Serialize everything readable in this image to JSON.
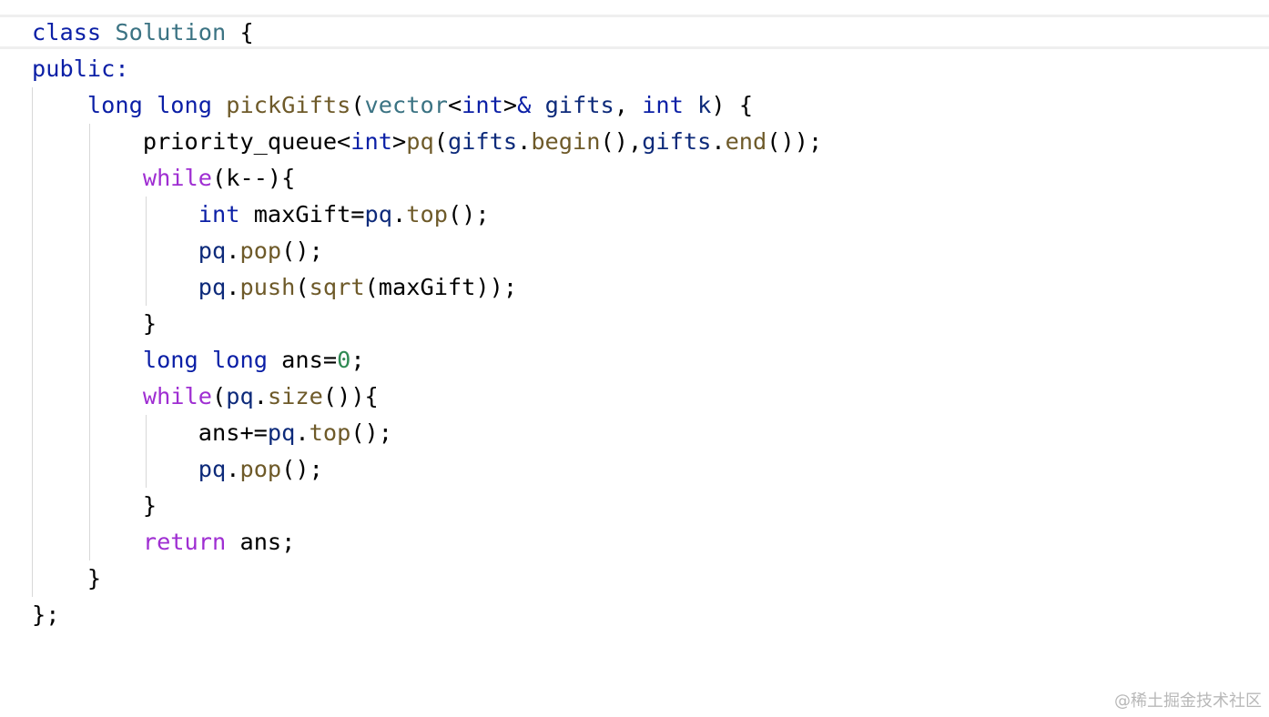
{
  "code": {
    "lines": [
      {
        "tokens": [
          {
            "text": "class",
            "kind": "keyword"
          },
          {
            "text": " ",
            "kind": "plain"
          },
          {
            "text": "Solution",
            "kind": "type"
          },
          {
            "text": " {",
            "kind": "plain"
          }
        ]
      },
      {
        "tokens": [
          {
            "text": "public",
            "kind": "keyword"
          },
          {
            "text": ":",
            "kind": "keyword"
          }
        ]
      },
      {
        "tokens": [
          {
            "text": "    ",
            "kind": "plain"
          },
          {
            "text": "long",
            "kind": "keyword"
          },
          {
            "text": " ",
            "kind": "plain"
          },
          {
            "text": "long",
            "kind": "keyword"
          },
          {
            "text": " ",
            "kind": "plain"
          },
          {
            "text": "pickGifts",
            "kind": "func"
          },
          {
            "text": "(",
            "kind": "plain"
          },
          {
            "text": "vector",
            "kind": "type"
          },
          {
            "text": "<",
            "kind": "plain"
          },
          {
            "text": "int",
            "kind": "keyword"
          },
          {
            "text": ">",
            "kind": "plain"
          },
          {
            "text": "&",
            "kind": "keyword"
          },
          {
            "text": " ",
            "kind": "plain"
          },
          {
            "text": "gifts",
            "kind": "ident"
          },
          {
            "text": ", ",
            "kind": "plain"
          },
          {
            "text": "int",
            "kind": "keyword"
          },
          {
            "text": " ",
            "kind": "plain"
          },
          {
            "text": "k",
            "kind": "ident"
          },
          {
            "text": ") {",
            "kind": "plain"
          }
        ]
      },
      {
        "tokens": [
          {
            "text": "        priority_queue<",
            "kind": "plain"
          },
          {
            "text": "int",
            "kind": "keyword"
          },
          {
            "text": ">",
            "kind": "plain"
          },
          {
            "text": "pq",
            "kind": "func"
          },
          {
            "text": "(",
            "kind": "plain"
          },
          {
            "text": "gifts",
            "kind": "ident"
          },
          {
            "text": ".",
            "kind": "plain"
          },
          {
            "text": "begin",
            "kind": "func"
          },
          {
            "text": "(),",
            "kind": "plain"
          },
          {
            "text": "gifts",
            "kind": "ident"
          },
          {
            "text": ".",
            "kind": "plain"
          },
          {
            "text": "end",
            "kind": "func"
          },
          {
            "text": "());",
            "kind": "plain"
          }
        ]
      },
      {
        "tokens": [
          {
            "text": "        ",
            "kind": "plain"
          },
          {
            "text": "while",
            "kind": "control"
          },
          {
            "text": "(k--){",
            "kind": "plain"
          }
        ]
      },
      {
        "tokens": [
          {
            "text": "            ",
            "kind": "plain"
          },
          {
            "text": "int",
            "kind": "keyword"
          },
          {
            "text": " maxGift=",
            "kind": "plain"
          },
          {
            "text": "pq",
            "kind": "ident"
          },
          {
            "text": ".",
            "kind": "plain"
          },
          {
            "text": "top",
            "kind": "func"
          },
          {
            "text": "();",
            "kind": "plain"
          }
        ]
      },
      {
        "tokens": [
          {
            "text": "            ",
            "kind": "plain"
          },
          {
            "text": "pq",
            "kind": "ident"
          },
          {
            "text": ".",
            "kind": "plain"
          },
          {
            "text": "pop",
            "kind": "func"
          },
          {
            "text": "();",
            "kind": "plain"
          }
        ]
      },
      {
        "tokens": [
          {
            "text": "            ",
            "kind": "plain"
          },
          {
            "text": "pq",
            "kind": "ident"
          },
          {
            "text": ".",
            "kind": "plain"
          },
          {
            "text": "push",
            "kind": "func"
          },
          {
            "text": "(",
            "kind": "plain"
          },
          {
            "text": "sqrt",
            "kind": "func"
          },
          {
            "text": "(maxGift));",
            "kind": "plain"
          }
        ]
      },
      {
        "tokens": [
          {
            "text": "        }",
            "kind": "plain"
          }
        ]
      },
      {
        "tokens": [
          {
            "text": "        ",
            "kind": "plain"
          },
          {
            "text": "long",
            "kind": "keyword"
          },
          {
            "text": " ",
            "kind": "plain"
          },
          {
            "text": "long",
            "kind": "keyword"
          },
          {
            "text": " ans=",
            "kind": "plain"
          },
          {
            "text": "0",
            "kind": "number"
          },
          {
            "text": ";",
            "kind": "plain"
          }
        ]
      },
      {
        "tokens": [
          {
            "text": "        ",
            "kind": "plain"
          },
          {
            "text": "while",
            "kind": "control"
          },
          {
            "text": "(",
            "kind": "plain"
          },
          {
            "text": "pq",
            "kind": "ident"
          },
          {
            "text": ".",
            "kind": "plain"
          },
          {
            "text": "size",
            "kind": "func"
          },
          {
            "text": "()){",
            "kind": "plain"
          }
        ]
      },
      {
        "tokens": [
          {
            "text": "            ans+=",
            "kind": "plain"
          },
          {
            "text": "pq",
            "kind": "ident"
          },
          {
            "text": ".",
            "kind": "plain"
          },
          {
            "text": "top",
            "kind": "func"
          },
          {
            "text": "();",
            "kind": "plain"
          }
        ]
      },
      {
        "tokens": [
          {
            "text": "            ",
            "kind": "plain"
          },
          {
            "text": "pq",
            "kind": "ident"
          },
          {
            "text": ".",
            "kind": "plain"
          },
          {
            "text": "pop",
            "kind": "func"
          },
          {
            "text": "();",
            "kind": "plain"
          }
        ]
      },
      {
        "tokens": [
          {
            "text": "        }",
            "kind": "plain"
          }
        ]
      },
      {
        "tokens": [
          {
            "text": "        ",
            "kind": "plain"
          },
          {
            "text": "return",
            "kind": "control"
          },
          {
            "text": " ans;",
            "kind": "plain"
          }
        ]
      },
      {
        "tokens": [
          {
            "text": "    }",
            "kind": "plain"
          }
        ]
      },
      {
        "tokens": [
          {
            "text": "};",
            "kind": "plain"
          }
        ]
      }
    ]
  },
  "watermark": {
    "text": "@稀土掘金技术社区"
  },
  "colors": {
    "keyword": "#0b1fa6",
    "type": "#3b7383",
    "func": "#6e5a29",
    "control": "#9f2ed2",
    "ident": "#0d2a7a",
    "number": "#2f8a53",
    "plain": "#000000"
  }
}
